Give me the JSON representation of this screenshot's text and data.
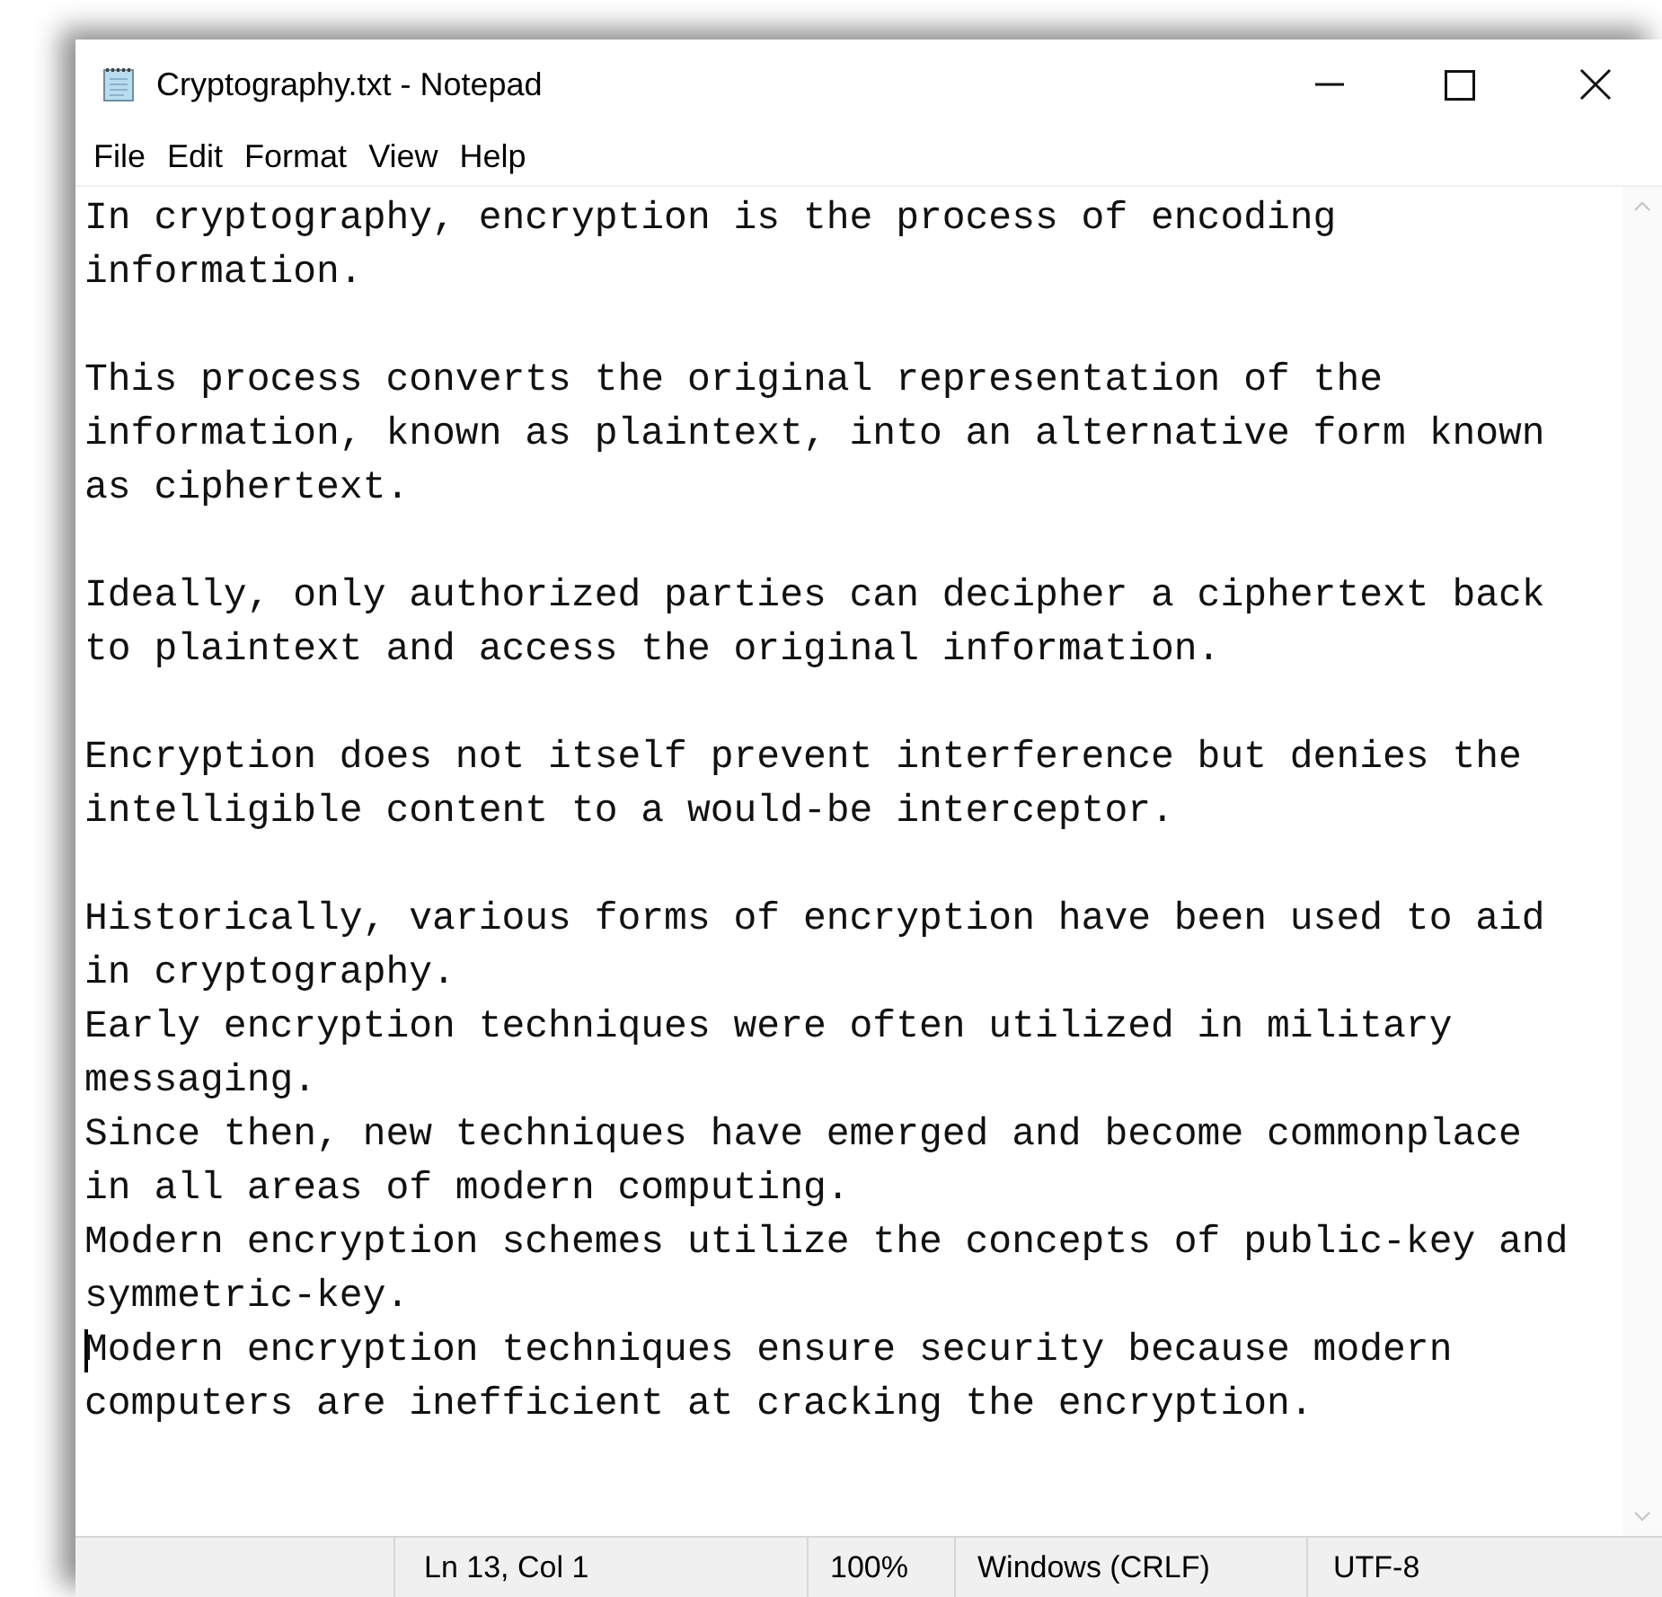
{
  "window": {
    "title": "Cryptography.txt - Notepad"
  },
  "menu": [
    "File",
    "Edit",
    "Format",
    "View",
    "Help"
  ],
  "document": {
    "blocks": [
      [
        {
          "text": "In cryptography, encryption is the process of encoding",
          "caret": false
        },
        {
          "text": "information.",
          "caret": false
        }
      ],
      [
        {
          "text": "This process converts the original representation of the",
          "caret": false
        },
        {
          "text": "information, known as plaintext, into an alternative form known",
          "caret": false
        },
        {
          "text": "as ciphertext.",
          "caret": false
        }
      ],
      [
        {
          "text": "Ideally, only authorized parties can decipher a ciphertext back",
          "caret": false
        },
        {
          "text": "to plaintext and access the original information.",
          "caret": false
        }
      ],
      [
        {
          "text": "Encryption does not itself prevent interference but denies the",
          "caret": false
        },
        {
          "text": "intelligible content to a would-be interceptor.",
          "caret": false
        }
      ],
      [
        {
          "text": "Historically, various forms of encryption have been used to aid",
          "caret": false
        },
        {
          "text": "in cryptography.",
          "caret": false
        },
        {
          "text": "Early encryption techniques were often utilized in military",
          "caret": false
        },
        {
          "text": "messaging.",
          "caret": false
        },
        {
          "text": "Since then, new techniques have emerged and become commonplace",
          "caret": false
        },
        {
          "text": "in all areas of modern computing.",
          "caret": false
        },
        {
          "text": "Modern encryption schemes utilize the concepts of public-key and",
          "caret": false
        },
        {
          "text": "symmetric-key.",
          "caret": false
        },
        {
          "text": "Modern encryption techniques ensure security because modern",
          "caret": true
        },
        {
          "text": "computers are inefficient at cracking the encryption.",
          "caret": false
        }
      ]
    ]
  },
  "status_bar": {
    "position": "Ln 13, Col 1",
    "zoom": "100%",
    "line_ending": "Windows (CRLF)",
    "encoding": "UTF-8"
  }
}
